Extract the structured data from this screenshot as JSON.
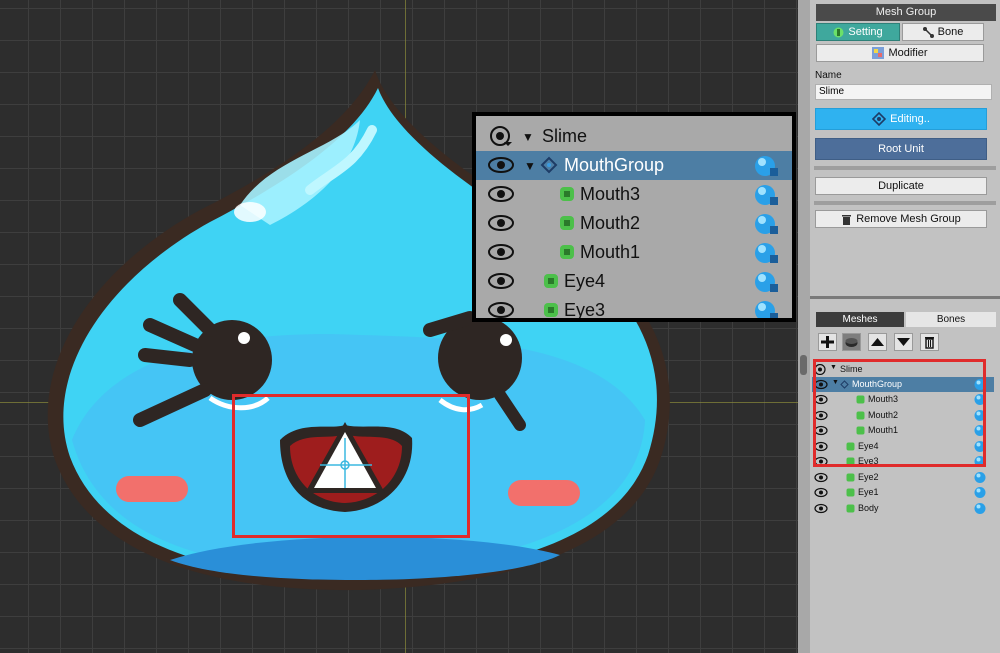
{
  "inspector": {
    "title": "Mesh Group",
    "tabs": {
      "setting": "Setting",
      "bone": "Bone"
    },
    "modifier_label": "Modifier",
    "name_label": "Name",
    "name_value": "Slime",
    "editing_label": "Editing..",
    "root_unit_label": "Root Unit",
    "duplicate_label": "Duplicate",
    "remove_label": "Remove Mesh Group"
  },
  "panel_tabs": {
    "meshes": "Meshes",
    "bones": "Bones"
  },
  "hierarchy": {
    "root": "Slime",
    "items": [
      {
        "label": "MouthGroup",
        "type": "group",
        "selected": true
      },
      {
        "label": "Mouth3",
        "type": "mesh"
      },
      {
        "label": "Mouth2",
        "type": "mesh"
      },
      {
        "label": "Mouth1",
        "type": "mesh"
      },
      {
        "label": "Eye4",
        "type": "mesh"
      },
      {
        "label": "Eye3",
        "type": "mesh"
      },
      {
        "label": "Eye2",
        "type": "mesh"
      },
      {
        "label": "Eye1",
        "type": "mesh"
      },
      {
        "label": "Body",
        "type": "mesh"
      }
    ]
  },
  "icons": [
    "eye-icon",
    "mesh-icon",
    "mesh-group-icon",
    "bone-icon",
    "modifier-icon",
    "trash-icon",
    "plus-icon",
    "arrow-up-icon",
    "arrow-down-icon",
    "sphere-visibility-icon"
  ],
  "colors": {
    "selection": "#4d7ea4",
    "accent_teal": "#3fa89d",
    "editing_blue": "#2fb2f0",
    "highlight_red": "#e02b2b"
  }
}
